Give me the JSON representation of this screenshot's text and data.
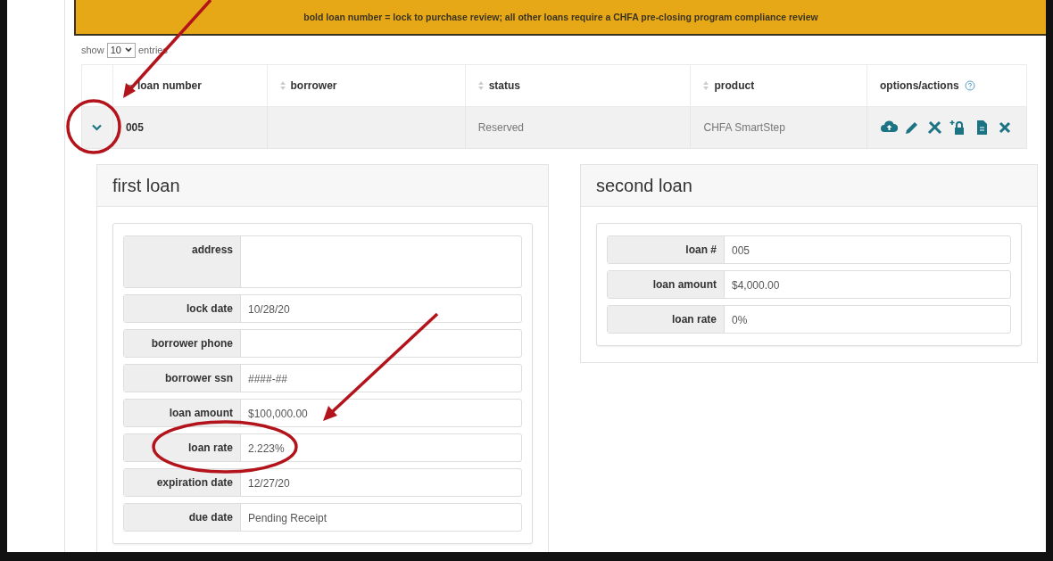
{
  "banner": {
    "text": "bold loan number = lock to purchase review; all other loans require a CHFA pre-closing program compliance review"
  },
  "length_menu": {
    "prefix": "show",
    "value": "10",
    "suffix": "entries"
  },
  "table": {
    "columns": [
      {
        "label": "loan number",
        "sortable": true,
        "sorted": true,
        "help": false
      },
      {
        "label": "borrower",
        "sortable": true,
        "sorted": false,
        "help": false
      },
      {
        "label": "status",
        "sortable": true,
        "sorted": false,
        "help": false
      },
      {
        "label": "product",
        "sortable": true,
        "sorted": false,
        "help": false
      },
      {
        "label": "options/actions",
        "sortable": false,
        "sorted": false,
        "help": true
      }
    ],
    "rows": [
      {
        "expanded": true,
        "loan_number": "005",
        "status": "Reserved",
        "product": "CHFA SmartStep"
      }
    ]
  },
  "panels": [
    {
      "title": "first loan",
      "fields": [
        {
          "label": "address",
          "kind": "tall"
        },
        {
          "label": "lock date",
          "value": "10/28/20"
        },
        {
          "label": "borrower phone"
        },
        {
          "label": "borrower ssn",
          "value": "####-##"
        },
        {
          "label": "loan amount",
          "value": "$100,000.00"
        },
        {
          "label": "loan rate",
          "value": "2.223%"
        },
        {
          "label": "expiration date",
          "value": "12/27/20"
        },
        {
          "label": "due date",
          "value": "Pending Receipt"
        }
      ]
    },
    {
      "title": "second loan",
      "fields": [
        {
          "label": "loan #",
          "value": "005"
        },
        {
          "label": "loan amount",
          "value": "$4,000.00"
        },
        {
          "label": "loan rate",
          "value": "0%"
        }
      ]
    }
  ]
}
